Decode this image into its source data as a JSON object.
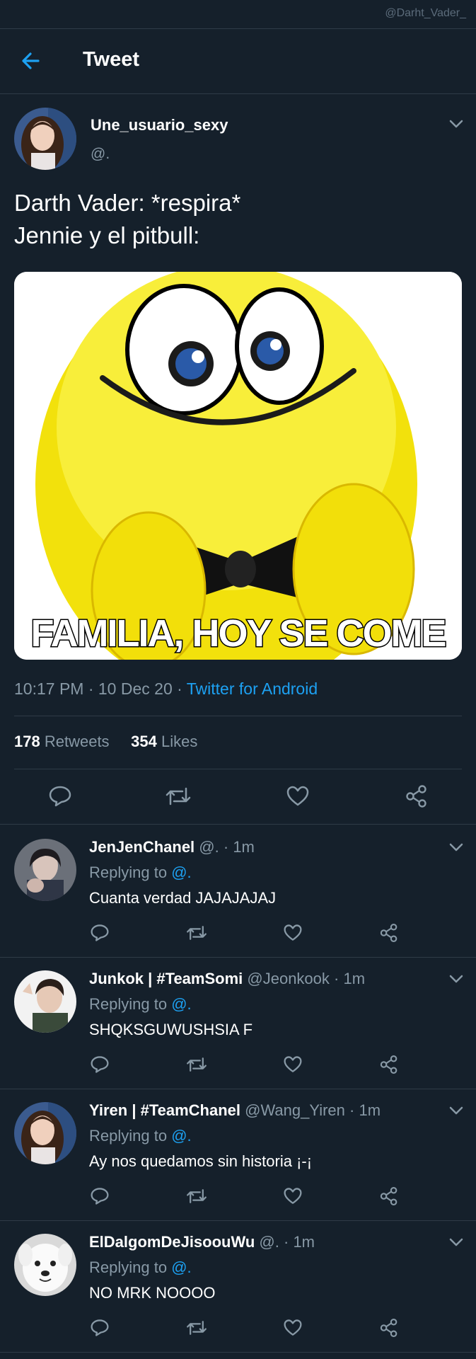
{
  "watermark": "@Darht_Vader_",
  "header": {
    "title": "Tweet",
    "back_icon": "arrow-left-icon"
  },
  "tweet": {
    "author_name": "Une_usuario_sexy",
    "author_handle": "@.",
    "text_line1": "Darth Vader: *respira*",
    "text_line2": "Jennie y el pitbull:",
    "media_caption": "FAMILIA, HOY SE COME",
    "time": "10:17 PM · 10 Dec 20 · ",
    "source": "Twitter for Android",
    "retweets_count": "178",
    "retweets_label": "Retweets",
    "likes_count": "354",
    "likes_label": "Likes"
  },
  "replies": [
    {
      "name": "JenJenChanel",
      "handle": "@.",
      "time": "· 1m",
      "replying_label": "Replying to",
      "mention": "@.",
      "text": "Cuanta verdad JAJAJAJAJ"
    },
    {
      "name": "Junkok | #TeamSomi",
      "handle": "@Jeonkook",
      "time": "· 1m",
      "replying_label": "Replying to",
      "mention": "@.",
      "text": "SHQKSGUWUSHSIA F"
    },
    {
      "name": "Yiren | #TeamChanel",
      "handle": "@Wang_Yiren",
      "time": "· 1m",
      "replying_label": "Replying to",
      "mention": "@.",
      "text": "Ay nos quedamos sin historia ¡-¡"
    },
    {
      "name": "ElDalgomDeJisoouWu",
      "handle": "@.",
      "time": "· 1m",
      "replying_label": "Replying to",
      "mention": "@.",
      "text": "NO MRK NOOOO"
    }
  ],
  "colors": {
    "background": "#15202b",
    "accent": "#1da1f2",
    "muted": "#8899a6",
    "divider": "#2f3b47"
  }
}
